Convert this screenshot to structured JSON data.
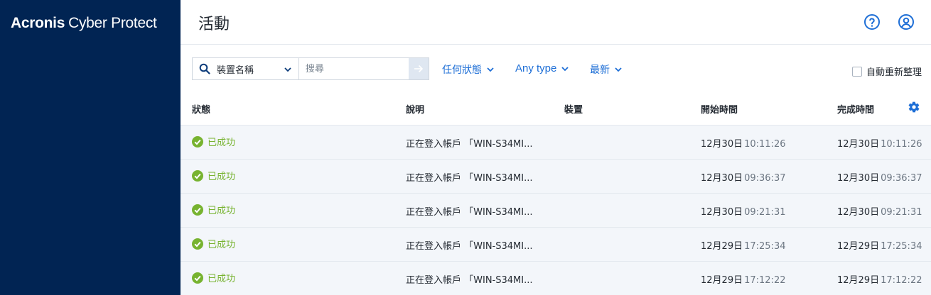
{
  "brand": {
    "name_bold": "Acronis",
    "name_light": "Cyber Protect"
  },
  "header": {
    "title": "活動"
  },
  "filters": {
    "search_field": "裝置名稱",
    "search_placeholder": "搜尋",
    "status_filter": "任何狀態",
    "type_filter": "Any type",
    "sort_filter": "最新",
    "auto_arrange_label": "自動重新整理"
  },
  "table": {
    "columns": {
      "status": "狀態",
      "description": "說明",
      "device": "裝置",
      "start_time": "開始時間",
      "end_time": "完成時間"
    },
    "rows": [
      {
        "status": "已成功",
        "description": "正在登入帳戶 「WIN-S34MI...",
        "device": "",
        "start_date": "12月30日",
        "start_time": "10:11:26",
        "end_date": "12月30日",
        "end_time": "10:11:26"
      },
      {
        "status": "已成功",
        "description": "正在登入帳戶 「WIN-S34MI...",
        "device": "",
        "start_date": "12月30日",
        "start_time": "09:36:37",
        "end_date": "12月30日",
        "end_time": "09:36:37"
      },
      {
        "status": "已成功",
        "description": "正在登入帳戶 「WIN-S34MI...",
        "device": "",
        "start_date": "12月30日",
        "start_time": "09:21:31",
        "end_date": "12月30日",
        "end_time": "09:21:31"
      },
      {
        "status": "已成功",
        "description": "正在登入帳戶 「WIN-S34MI...",
        "device": "",
        "start_date": "12月29日",
        "start_time": "17:25:34",
        "end_date": "12月29日",
        "end_time": "17:25:34"
      },
      {
        "status": "已成功",
        "description": "正在登入帳戶 「WIN-S34MI...",
        "device": "",
        "start_date": "12月29日",
        "start_time": "17:12:22",
        "end_date": "12月29日",
        "end_time": "17:12:22"
      }
    ]
  },
  "colors": {
    "sidebar": "#012453",
    "accent": "#1d6ed6",
    "success": "#77b330",
    "row_bg": "#f3f6fa"
  },
  "icons": {
    "help": "help-circle-icon",
    "account": "user-circle-icon",
    "search": "search-icon",
    "go": "arrow-right-icon",
    "settings": "gear-icon",
    "success": "check-circle-icon"
  }
}
